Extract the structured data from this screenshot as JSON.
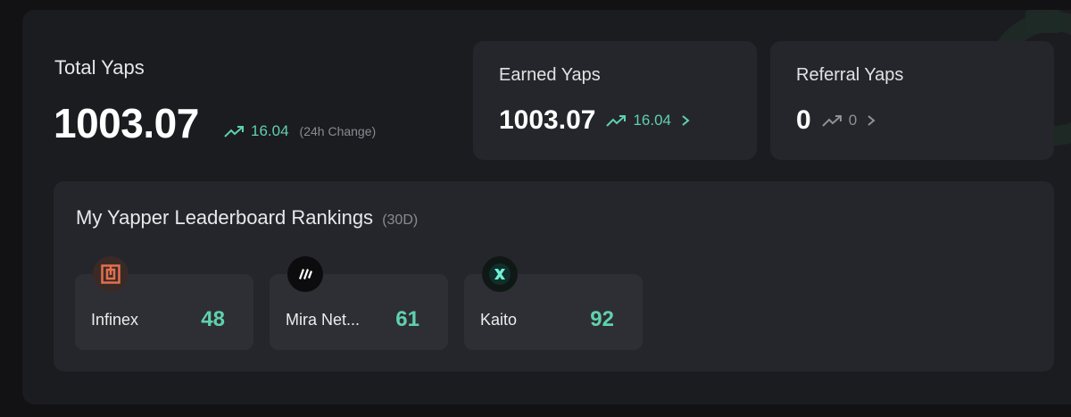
{
  "total": {
    "label": "Total Yaps",
    "value": "1003.07",
    "change": "16.04",
    "change_note": "(24h Change)"
  },
  "earned": {
    "label": "Earned Yaps",
    "value": "1003.07",
    "change": "16.04"
  },
  "referral": {
    "label": "Referral Yaps",
    "value": "0",
    "change": "0"
  },
  "leaderboard": {
    "title": "My Yapper Leaderboard Rankings",
    "period": "(30D)",
    "items": [
      {
        "name": "Infinex",
        "score": "48",
        "icon": "infinex-logo-icon"
      },
      {
        "name": "Mira Net...",
        "score": "61",
        "icon": "mira-logo-icon"
      },
      {
        "name": "Kaito",
        "score": "92",
        "icon": "kaito-logo-icon"
      }
    ]
  },
  "colors": {
    "accent_green": "#5fd1ad",
    "background": "#121215",
    "panel": "#1b1c20",
    "card": "#25262b"
  }
}
